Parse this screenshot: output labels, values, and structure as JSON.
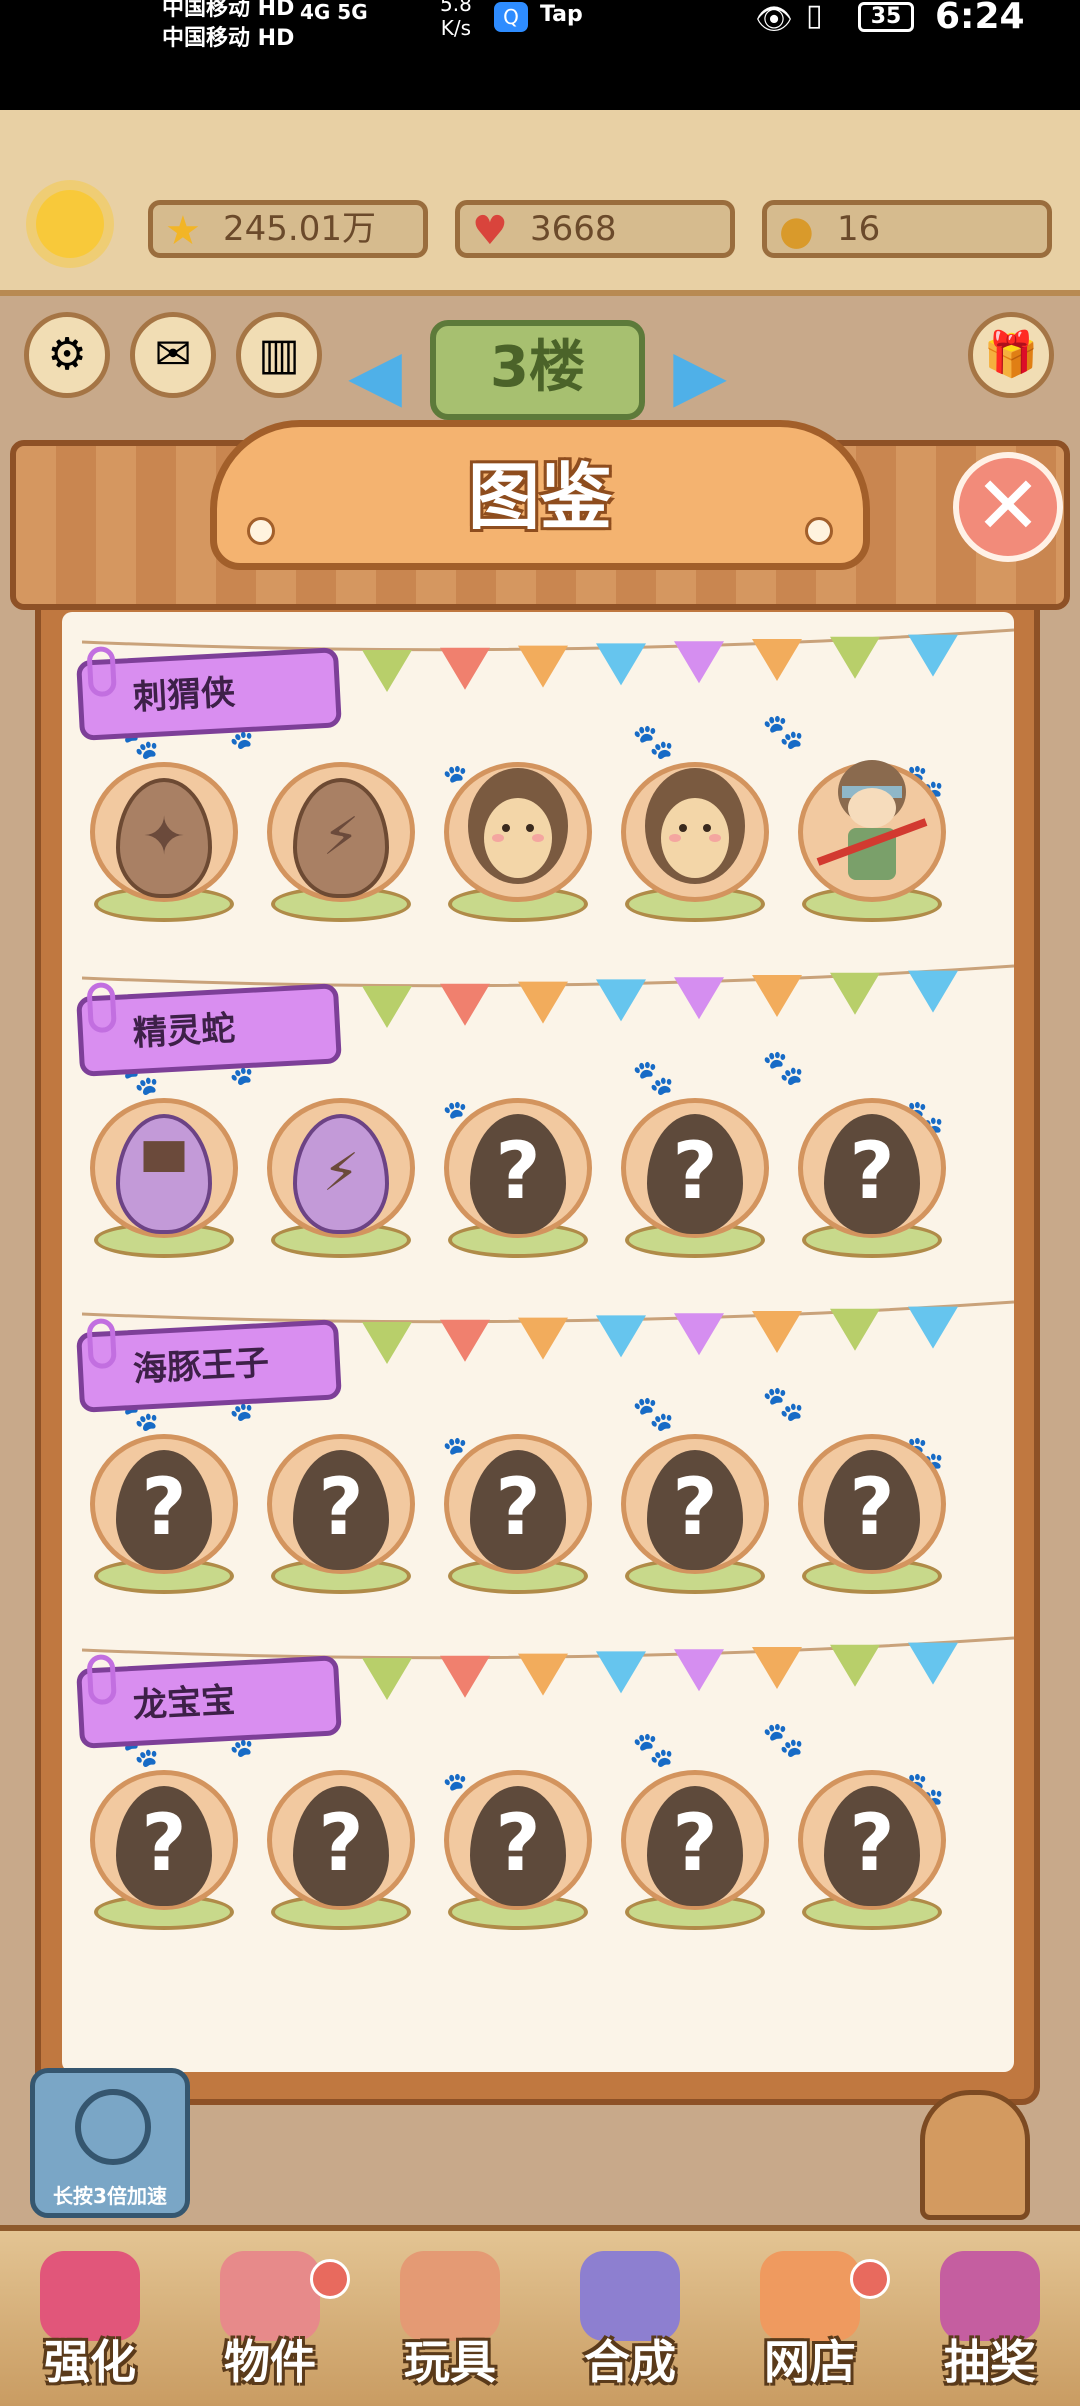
{
  "status_bar": {
    "carrier_1": "中国移动 HD",
    "carrier_2": "中国移动 HD",
    "network": "4G 5G",
    "speed": "5.8\nK/s",
    "app": "Tap",
    "battery": "35",
    "time": "6:24"
  },
  "resources": {
    "stars": "245.01万",
    "hearts": "3668",
    "coins": "16"
  },
  "floor": "3楼",
  "modal": {
    "title": "图鉴",
    "categories": [
      {
        "name": "刺猬侠",
        "slots": [
          "egg-shuriken",
          "egg-cracked",
          "hedgehog-baby",
          "hedgehog-teen",
          "hedgehog-ninja"
        ]
      },
      {
        "name": "精灵蛇",
        "slots": [
          "egg-purple",
          "egg-purple-cracked",
          "unknown",
          "unknown",
          "unknown"
        ]
      },
      {
        "name": "海豚王子",
        "slots": [
          "unknown",
          "unknown",
          "unknown",
          "unknown",
          "unknown"
        ]
      },
      {
        "name": "龙宝宝",
        "slots": [
          "unknown",
          "unknown",
          "unknown",
          "unknown",
          "unknown"
        ]
      }
    ],
    "unknown_mark": "?"
  },
  "speed_button": "长按3倍加速",
  "nav": [
    "强化",
    "物件",
    "玩具",
    "合成",
    "网店",
    "抽奖"
  ]
}
